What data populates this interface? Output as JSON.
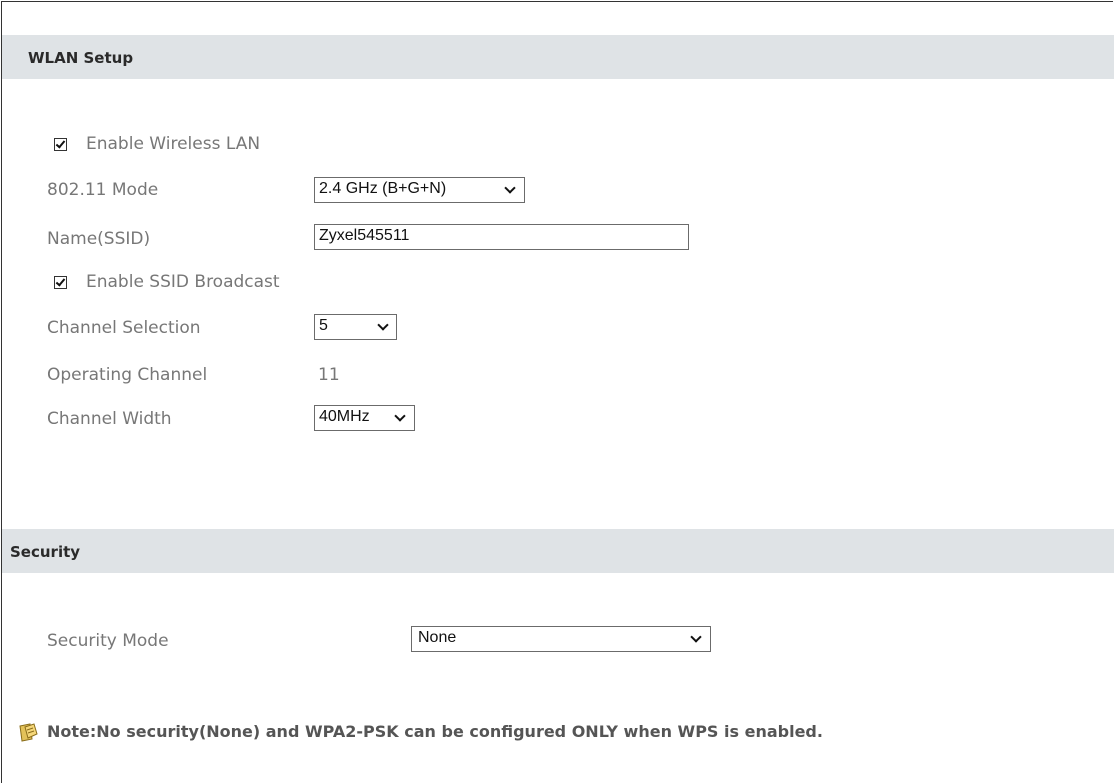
{
  "wlan": {
    "title": "WLAN Setup",
    "enable_wireless_label": "Enable Wireless LAN",
    "enable_wireless_checked": true,
    "mode_label": "802.11 Mode",
    "mode_value": "2.4 GHz (B+G+N)",
    "ssid_label": "Name(SSID)",
    "ssid_value": "Zyxel545511",
    "broadcast_label": "Enable SSID Broadcast",
    "broadcast_checked": true,
    "channel_sel_label": "Channel Selection",
    "channel_sel_value": "5",
    "operating_label": "Operating Channel",
    "operating_value": "11",
    "width_label": "Channel Width",
    "width_value": "40MHz"
  },
  "security": {
    "title": "Security",
    "mode_label": "Security Mode",
    "mode_value": "None"
  },
  "note": {
    "icon": "note-pencil-icon",
    "text": "Note:No security(None) and WPA2-PSK can be configured ONLY when WPS is enabled."
  }
}
